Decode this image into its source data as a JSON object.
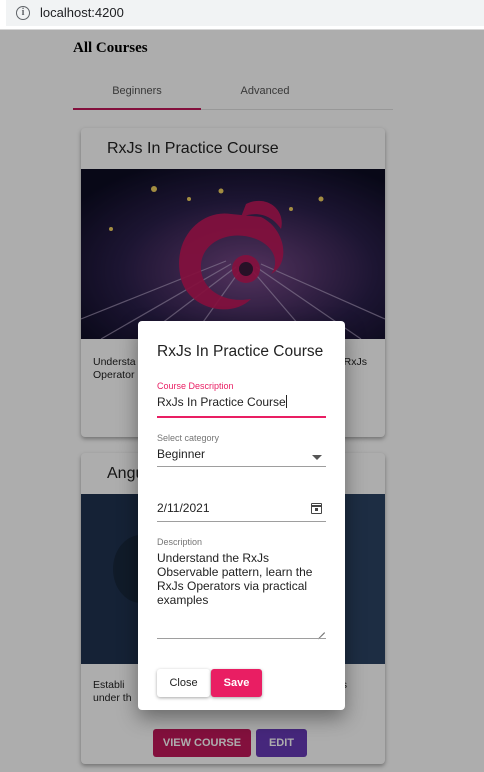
{
  "browser": {
    "url": "localhost:4200"
  },
  "page": {
    "title": "All Courses",
    "tabs": [
      {
        "label": "Beginners",
        "active": true
      },
      {
        "label": "Advanced",
        "active": false
      }
    ]
  },
  "cards": [
    {
      "title": "RxJs In Practice Course",
      "description": "Understa                                                              RxJs Operator",
      "description_left": "Understa",
      "description_left2": "Operator",
      "description_right": "RxJs"
    },
    {
      "title": "Angu",
      "description_left": "Establi",
      "description_left2": "under th",
      "description_right": "s",
      "view_label": "VIEW COURSE",
      "edit_label": "EDIT"
    }
  ],
  "dialog": {
    "title": "RxJs In Practice Course",
    "course_description_label": "Course Description",
    "course_description_value": "RxJs In Practice Course",
    "category_label": "Select category",
    "category_value": "Beginner",
    "date_value": "2/11/2021",
    "description_label": "Description",
    "description_value": "Understand the RxJs Observable pattern, learn the RxJs Operators via practical examples",
    "close_label": "Close",
    "save_label": "Save"
  },
  "colors": {
    "primary": "#c2185b",
    "accent": "#e91e63",
    "edit": "#673ab7"
  }
}
